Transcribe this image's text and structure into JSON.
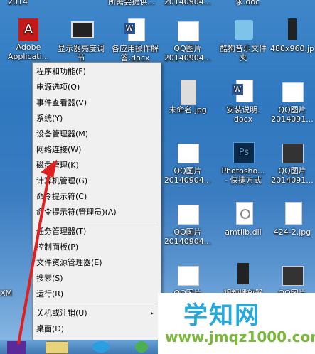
{
  "desktop": {
    "top_row": [
      "2014",
      "所需要提供...",
      "20140904...",
      "求.doc"
    ],
    "icons": [
      {
        "label": "Adobe\nApplicati...",
        "icon": "adobe-app-icon",
        "color": "#c61a1a"
      },
      {
        "label": "显示器亮度调\n节",
        "icon": "monitor-shortcut-icon",
        "color": "#333"
      },
      {
        "label": "各应用操作解\n答.docx",
        "icon": "word-doc-icon",
        "color": "#2b5797"
      },
      {
        "label": "QQ图片\n20140904...",
        "icon": "image-file-icon",
        "color": "#fff"
      },
      {
        "label": "酷狗音乐文件\n夹",
        "icon": "kugou-folder-icon",
        "color": "#1a7ac9"
      },
      {
        "label": "480x960.jp",
        "icon": "phone-image-icon",
        "color": "#222"
      },
      {
        "label": "未命名.jpg",
        "icon": "image-file-icon",
        "color": "#fff"
      },
      {
        "label": "安装说明.\ndocx",
        "icon": "word-doc-icon",
        "color": "#2b5797"
      },
      {
        "label": "QQ图片\n2014091...",
        "icon": "image-file-icon",
        "color": "#fff"
      },
      {
        "label": "QQ图片\n20140904...",
        "icon": "image-file-icon",
        "color": "#fff"
      },
      {
        "label": "Photosho...\n- 快捷方式",
        "icon": "photoshop-icon",
        "color": "#0b2a4a"
      },
      {
        "label": "QQ图片\n2014091...",
        "icon": "image-file-icon",
        "color": "#fff"
      },
      {
        "label": "QQ图片\n20140904...",
        "icon": "image-file-icon",
        "color": "#fff"
      },
      {
        "label": "amtlib.dll",
        "icon": "dll-file-icon",
        "color": "#fff"
      },
      {
        "label": "424-2.jpg",
        "icon": "image-file-icon",
        "color": "#fff"
      },
      {
        "label": "QQ图片",
        "icon": "image-file-icon",
        "color": "#fff"
      },
      {
        "label": "视频播放器",
        "icon": "video-icon",
        "color": "#222"
      },
      {
        "label": "QQ图片",
        "icon": "image-file-icon",
        "color": "#fff"
      }
    ],
    "left_edge_text": "XM"
  },
  "context_menu": {
    "items": [
      {
        "label": "程序和功能(F)"
      },
      {
        "label": "电源选项(O)"
      },
      {
        "label": "事件查看器(V)"
      },
      {
        "label": "系统(Y)"
      },
      {
        "label": "设备管理器(M)"
      },
      {
        "label": "网络连接(W)"
      },
      {
        "label": "磁盘管理(K)"
      },
      {
        "label": "计算机管理(G)"
      },
      {
        "label": "命令提示符(C)"
      },
      {
        "label": "命令提示符(管理员)(A)"
      },
      {
        "label": "任务管理器(T)"
      },
      {
        "label": "控制面板(P)"
      },
      {
        "label": "文件资源管理器(E)"
      },
      {
        "label": "搜索(S)"
      },
      {
        "label": "运行(R)"
      },
      {
        "label": "关机或注销(U)",
        "submenu": "▸"
      },
      {
        "label": "桌面(D)"
      }
    ]
  },
  "watermark": {
    "title": "学知网",
    "url": "www.jmqz1000.com",
    "title_color": "#25a9dc",
    "url_color": "#7ab83a"
  },
  "annotation": {
    "arrow_color": "#e02020"
  }
}
